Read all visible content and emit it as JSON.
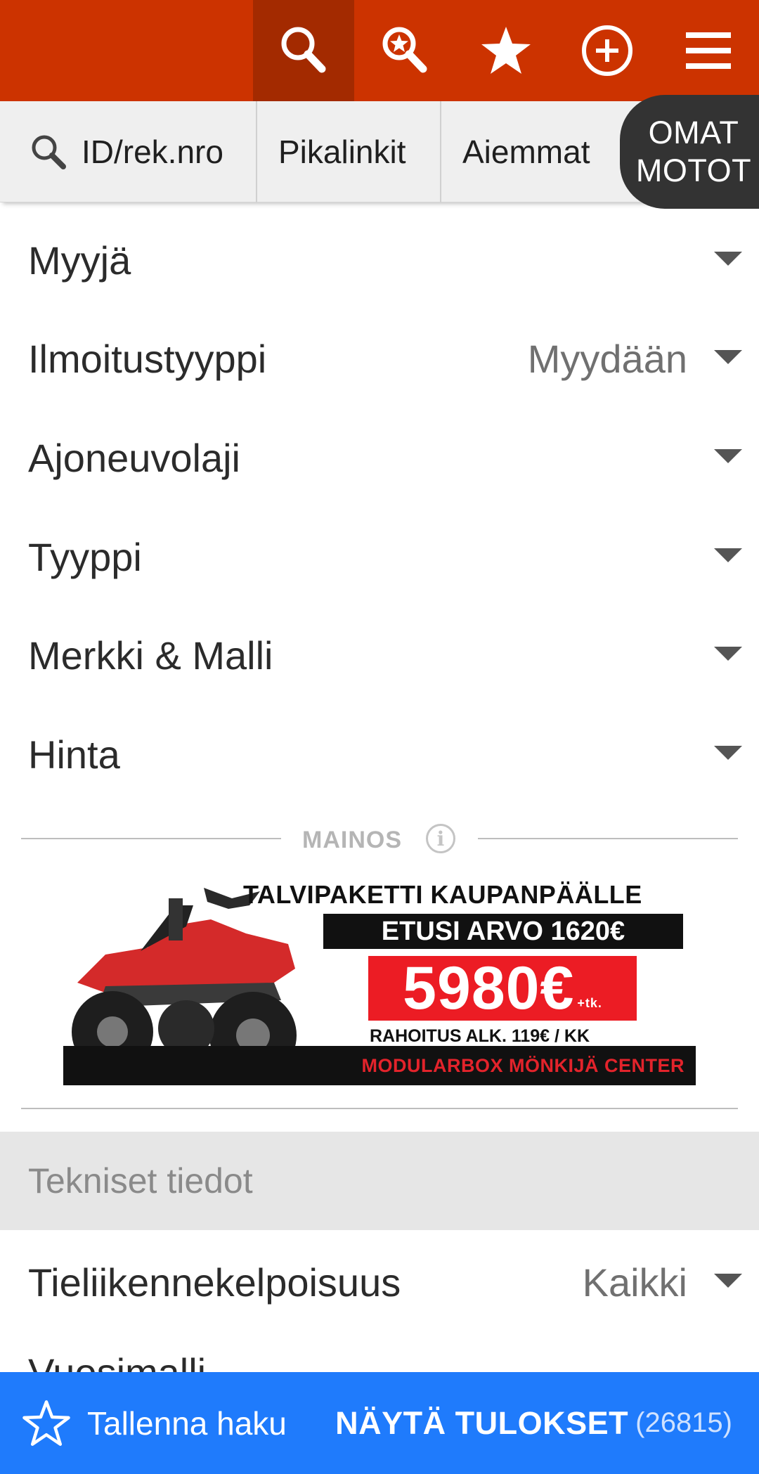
{
  "colors": {
    "header": "#cc3300",
    "header_active": "#a32a00",
    "bottom_bar": "#1f7bfc",
    "omat_bg": "#333333"
  },
  "topbar": {
    "icons": [
      "search-icon",
      "saved-search-icon",
      "favorites-star-icon",
      "add-listing-icon",
      "menu-icon"
    ],
    "active": "search-icon"
  },
  "subnav": {
    "search_label": "ID/rek.nro",
    "quicklinks_label": "Pikalinkit",
    "previous_label": "Aiemmat",
    "omat_line1": "OMAT",
    "omat_line2": "MOTOT"
  },
  "filters": [
    {
      "label": "Myyjä",
      "value": ""
    },
    {
      "label": "Ilmoitustyyppi",
      "value": "Myydään"
    },
    {
      "label": "Ajoneuvolaji",
      "value": ""
    },
    {
      "label": "Tyyppi",
      "value": ""
    },
    {
      "label": "Merkki & Malli",
      "value": ""
    },
    {
      "label": "Hinta",
      "value": ""
    }
  ],
  "ad": {
    "label": "MAINOS",
    "info": "i",
    "headline": "TALVIPAKETTI KAUPANPÄÄLLE",
    "value_line": "ETUSI ARVO 1620€",
    "price": "5980€",
    "price_suffix": "+tk.",
    "financing": "RAHOITUS ALK. 119€ / KK",
    "store": "MODULARBOX MÖNKIJÄ CENTER"
  },
  "section": {
    "title": "Tekniset tiedot"
  },
  "tech_filters": [
    {
      "label": "Tieliikennekelpoisuus",
      "value": "Kaikki"
    }
  ],
  "peek_row": {
    "label": "Vuosimalli"
  },
  "bottom": {
    "save_label": "Tallenna haku",
    "show_label": "NÄYTÄ TULOKSET",
    "count": "(26815)"
  }
}
